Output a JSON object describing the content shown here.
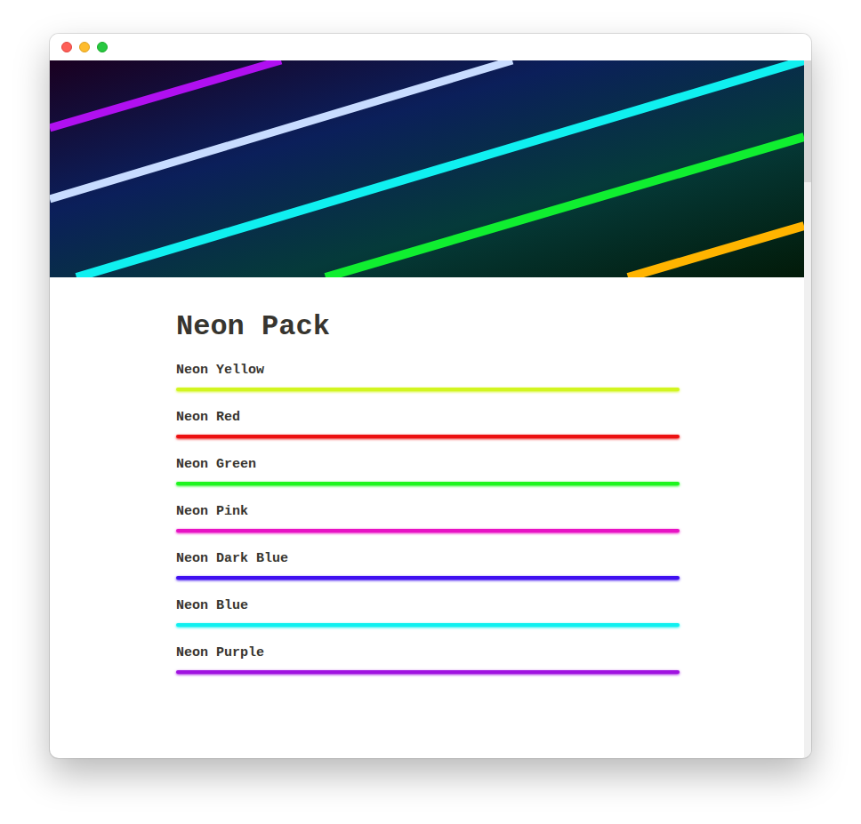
{
  "page": {
    "title": "Neon Pack"
  },
  "colors": [
    {
      "name": "Neon Yellow",
      "color": "#d2f520"
    },
    {
      "name": "Neon Red",
      "color": "#ec1111"
    },
    {
      "name": "Neon Green",
      "color": "#1ef51e"
    },
    {
      "name": "Neon Pink",
      "color": "#e812c4"
    },
    {
      "name": "Neon Dark Blue",
      "color": "#3f0ff0"
    },
    {
      "name": "Neon Blue",
      "color": "#10f0f0"
    },
    {
      "name": "Neon Purple",
      "color": "#a012e0"
    }
  ]
}
